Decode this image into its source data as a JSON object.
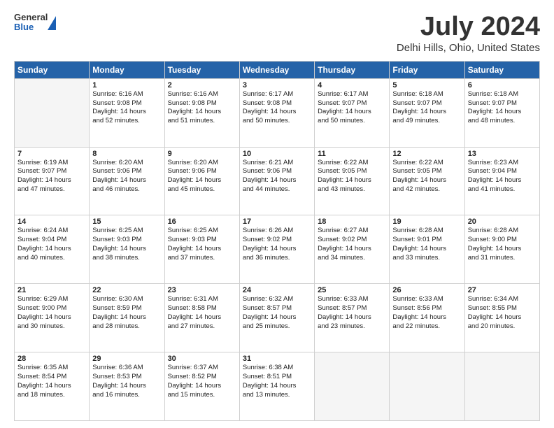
{
  "header": {
    "logo": {
      "line1": "General",
      "line2": "Blue"
    },
    "title": "July 2024",
    "subtitle": "Delhi Hills, Ohio, United States"
  },
  "calendar": {
    "days_of_week": [
      "Sunday",
      "Monday",
      "Tuesday",
      "Wednesday",
      "Thursday",
      "Friday",
      "Saturday"
    ],
    "weeks": [
      [
        {
          "day": "",
          "info": ""
        },
        {
          "day": "1",
          "info": "Sunrise: 6:16 AM\nSunset: 9:08 PM\nDaylight: 14 hours\nand 52 minutes."
        },
        {
          "day": "2",
          "info": "Sunrise: 6:16 AM\nSunset: 9:08 PM\nDaylight: 14 hours\nand 51 minutes."
        },
        {
          "day": "3",
          "info": "Sunrise: 6:17 AM\nSunset: 9:08 PM\nDaylight: 14 hours\nand 50 minutes."
        },
        {
          "day": "4",
          "info": "Sunrise: 6:17 AM\nSunset: 9:07 PM\nDaylight: 14 hours\nand 50 minutes."
        },
        {
          "day": "5",
          "info": "Sunrise: 6:18 AM\nSunset: 9:07 PM\nDaylight: 14 hours\nand 49 minutes."
        },
        {
          "day": "6",
          "info": "Sunrise: 6:18 AM\nSunset: 9:07 PM\nDaylight: 14 hours\nand 48 minutes."
        }
      ],
      [
        {
          "day": "7",
          "info": "Sunrise: 6:19 AM\nSunset: 9:07 PM\nDaylight: 14 hours\nand 47 minutes."
        },
        {
          "day": "8",
          "info": "Sunrise: 6:20 AM\nSunset: 9:06 PM\nDaylight: 14 hours\nand 46 minutes."
        },
        {
          "day": "9",
          "info": "Sunrise: 6:20 AM\nSunset: 9:06 PM\nDaylight: 14 hours\nand 45 minutes."
        },
        {
          "day": "10",
          "info": "Sunrise: 6:21 AM\nSunset: 9:06 PM\nDaylight: 14 hours\nand 44 minutes."
        },
        {
          "day": "11",
          "info": "Sunrise: 6:22 AM\nSunset: 9:05 PM\nDaylight: 14 hours\nand 43 minutes."
        },
        {
          "day": "12",
          "info": "Sunrise: 6:22 AM\nSunset: 9:05 PM\nDaylight: 14 hours\nand 42 minutes."
        },
        {
          "day": "13",
          "info": "Sunrise: 6:23 AM\nSunset: 9:04 PM\nDaylight: 14 hours\nand 41 minutes."
        }
      ],
      [
        {
          "day": "14",
          "info": "Sunrise: 6:24 AM\nSunset: 9:04 PM\nDaylight: 14 hours\nand 40 minutes."
        },
        {
          "day": "15",
          "info": "Sunrise: 6:25 AM\nSunset: 9:03 PM\nDaylight: 14 hours\nand 38 minutes."
        },
        {
          "day": "16",
          "info": "Sunrise: 6:25 AM\nSunset: 9:03 PM\nDaylight: 14 hours\nand 37 minutes."
        },
        {
          "day": "17",
          "info": "Sunrise: 6:26 AM\nSunset: 9:02 PM\nDaylight: 14 hours\nand 36 minutes."
        },
        {
          "day": "18",
          "info": "Sunrise: 6:27 AM\nSunset: 9:02 PM\nDaylight: 14 hours\nand 34 minutes."
        },
        {
          "day": "19",
          "info": "Sunrise: 6:28 AM\nSunset: 9:01 PM\nDaylight: 14 hours\nand 33 minutes."
        },
        {
          "day": "20",
          "info": "Sunrise: 6:28 AM\nSunset: 9:00 PM\nDaylight: 14 hours\nand 31 minutes."
        }
      ],
      [
        {
          "day": "21",
          "info": "Sunrise: 6:29 AM\nSunset: 9:00 PM\nDaylight: 14 hours\nand 30 minutes."
        },
        {
          "day": "22",
          "info": "Sunrise: 6:30 AM\nSunset: 8:59 PM\nDaylight: 14 hours\nand 28 minutes."
        },
        {
          "day": "23",
          "info": "Sunrise: 6:31 AM\nSunset: 8:58 PM\nDaylight: 14 hours\nand 27 minutes."
        },
        {
          "day": "24",
          "info": "Sunrise: 6:32 AM\nSunset: 8:57 PM\nDaylight: 14 hours\nand 25 minutes."
        },
        {
          "day": "25",
          "info": "Sunrise: 6:33 AM\nSunset: 8:57 PM\nDaylight: 14 hours\nand 23 minutes."
        },
        {
          "day": "26",
          "info": "Sunrise: 6:33 AM\nSunset: 8:56 PM\nDaylight: 14 hours\nand 22 minutes."
        },
        {
          "day": "27",
          "info": "Sunrise: 6:34 AM\nSunset: 8:55 PM\nDaylight: 14 hours\nand 20 minutes."
        }
      ],
      [
        {
          "day": "28",
          "info": "Sunrise: 6:35 AM\nSunset: 8:54 PM\nDaylight: 14 hours\nand 18 minutes."
        },
        {
          "day": "29",
          "info": "Sunrise: 6:36 AM\nSunset: 8:53 PM\nDaylight: 14 hours\nand 16 minutes."
        },
        {
          "day": "30",
          "info": "Sunrise: 6:37 AM\nSunset: 8:52 PM\nDaylight: 14 hours\nand 15 minutes."
        },
        {
          "day": "31",
          "info": "Sunrise: 6:38 AM\nSunset: 8:51 PM\nDaylight: 14 hours\nand 13 minutes."
        },
        {
          "day": "",
          "info": ""
        },
        {
          "day": "",
          "info": ""
        },
        {
          "day": "",
          "info": ""
        }
      ]
    ]
  }
}
